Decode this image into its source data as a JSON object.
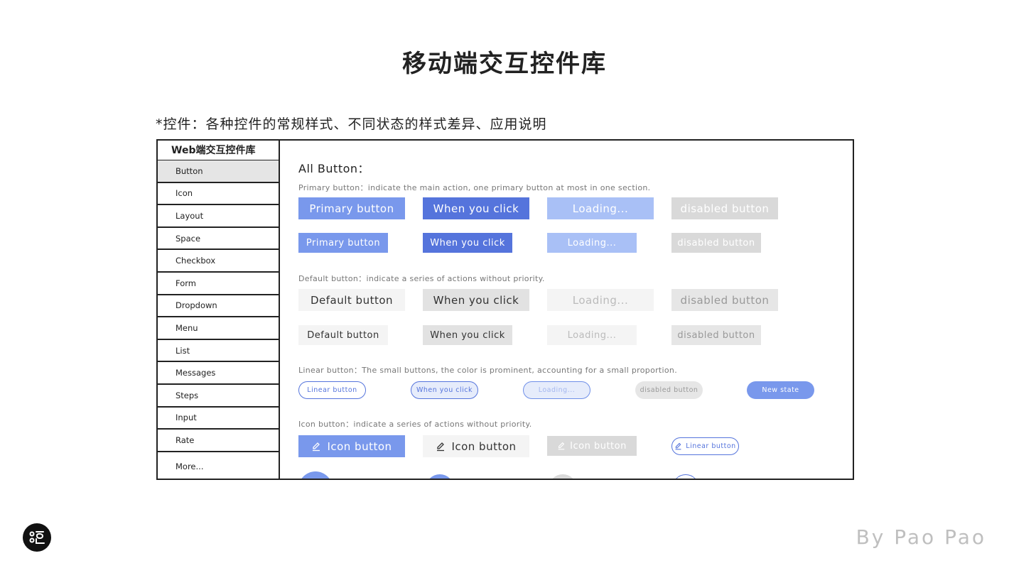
{
  "page_title": "移动端交互控件库",
  "subtitle": "*控件：各种控件的常规样式、不同状态的样式差异、应用说明",
  "sidebar": {
    "title": "Web端交互控件库",
    "items": [
      "Button",
      "Icon",
      "Layout",
      "Space",
      "Checkbox",
      "Form",
      "Dropdown",
      "Menu",
      "List",
      "Messages",
      "Steps",
      "Input",
      "Rate",
      "More..."
    ],
    "active_index": 0
  },
  "main": {
    "heading": "All Button：",
    "primary": {
      "desc": "Primary button：indicate the main action, one primary button at most in one section.",
      "labels": [
        "Primary button",
        "When you click",
        "Loading...",
        "disabled button"
      ]
    },
    "default": {
      "desc": "Default button：indicate a series of actions without priority.",
      "labels": [
        "Default button",
        "When you click",
        "Loading...",
        "disabled button"
      ]
    },
    "linear": {
      "desc": "Linear button：The small buttons, the color is prominent, accounting for a small proportion.",
      "labels": [
        "Linear button",
        "When you click",
        "Loading...",
        "disabled button",
        "New state"
      ]
    },
    "icon": {
      "desc": "Icon button：indicate a series of actions without priority.",
      "labels": [
        "Icon button",
        "Icon button",
        "Icon button",
        "Linear button"
      ],
      "icon": "pencil-icon"
    }
  },
  "byline": "By Pao Pao",
  "colors": {
    "primary": "#7998ec",
    "primary_active": "#5574dc",
    "primary_loading": "#a9c0f6",
    "disabled": "#d9d9d9"
  }
}
